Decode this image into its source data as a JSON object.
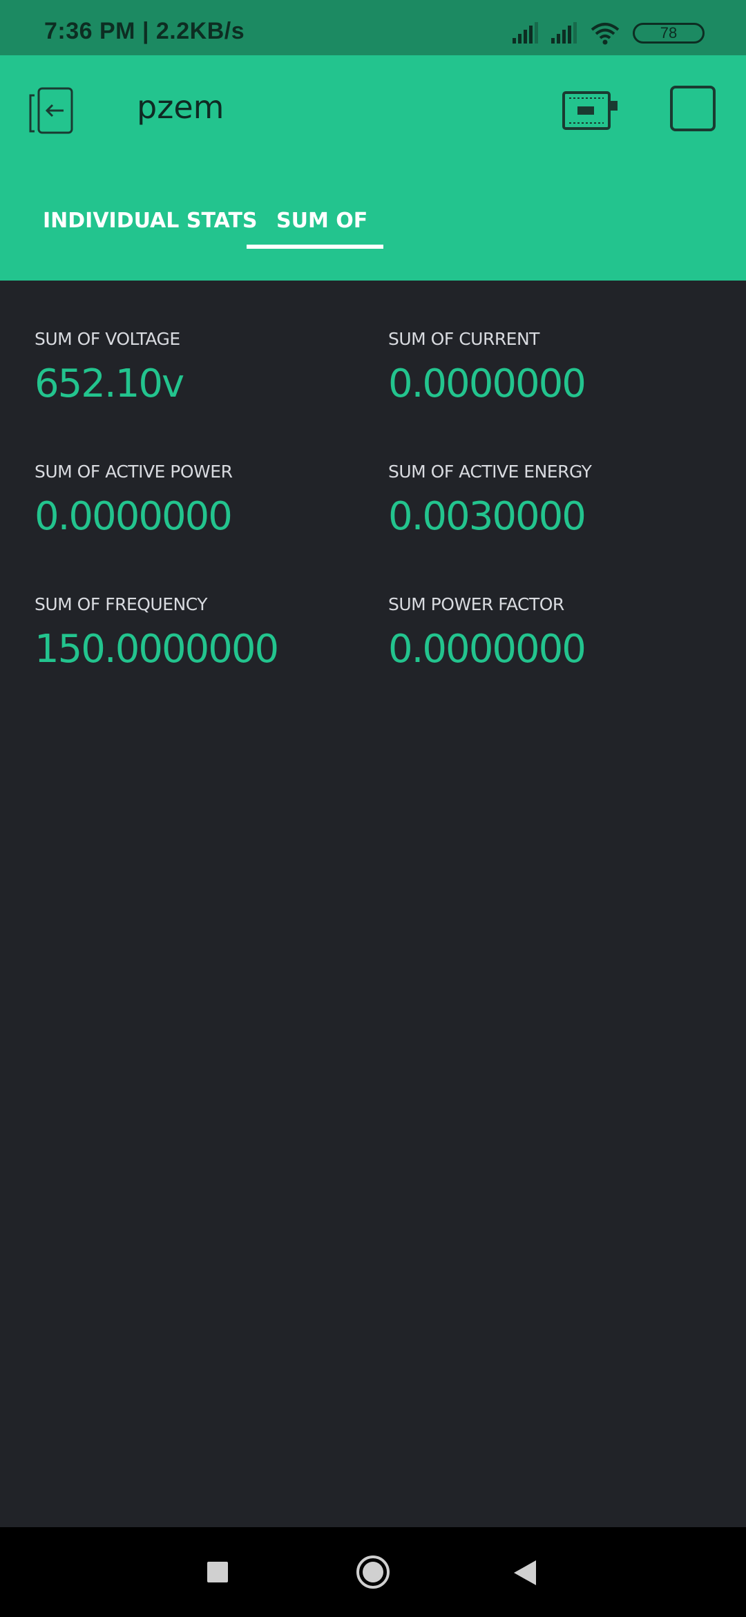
{
  "status_bar": {
    "time": "7:36 PM | 2.2KB/s",
    "battery": "78",
    "icons": [
      "signal-icon",
      "signal-icon",
      "wifi-icon",
      "battery-icon"
    ]
  },
  "app_bar": {
    "title": "pzem",
    "icons": [
      "back-icon",
      "device-icon",
      "stop-icon"
    ],
    "tabs": [
      {
        "label": "INDIVIDUAL STATS",
        "active": false
      },
      {
        "label": "SUM OF",
        "active": true
      }
    ]
  },
  "stats": [
    {
      "label": "SUM OF VOLTAGE",
      "value": "652.10v"
    },
    {
      "label": "SUM OF CURRENT",
      "value": "0.0000000"
    },
    {
      "label": "SUM OF ACTIVE POWER",
      "value": "0.0000000"
    },
    {
      "label": "SUM OF ACTIVE ENERGY",
      "value": "0.0030000"
    },
    {
      "label": "SUM OF FREQUENCY",
      "value": "150.0000000"
    },
    {
      "label": "SUM POWER FACTOR",
      "value": "0.0000000"
    }
  ],
  "nav_bar": {
    "icons": [
      "recents-icon",
      "home-icon",
      "back-triangle-icon"
    ]
  },
  "colors": {
    "accent": "#23c48e",
    "status_bar": "#1c8a62",
    "background": "#212328"
  }
}
